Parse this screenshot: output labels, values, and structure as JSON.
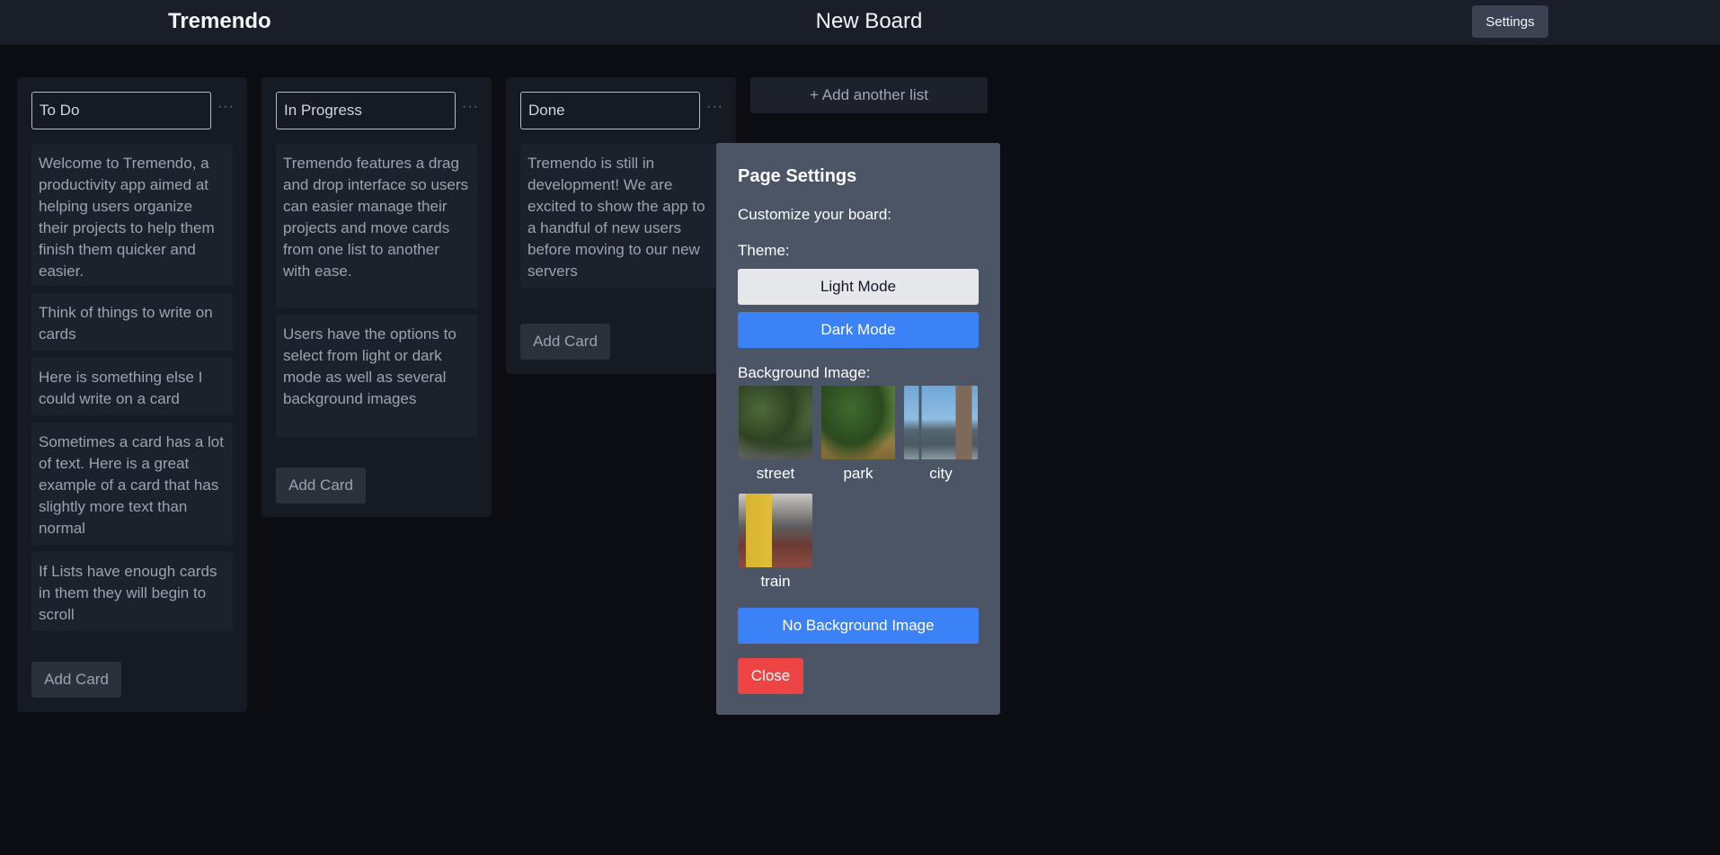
{
  "header": {
    "brand": "Tremendo",
    "board_title": "New Board",
    "settings_label": "Settings"
  },
  "lists": [
    {
      "title": "To Do",
      "menu_icon": "ellipsis-icon",
      "cards": [
        "Welcome to Tremendo, a productivity app aimed at helping users organize their projects to help them finish them quicker and easier.",
        "Think of things to write on cards",
        "Here is something else I could write on a card",
        "Sometimes a card has a lot of text. Here is a great example of a card that has slightly more text than normal",
        "If Lists have enough cards in them they will begin to scroll"
      ],
      "add_card_label": "Add Card"
    },
    {
      "title": "In Progress",
      "menu_icon": "ellipsis-icon",
      "cards": [
        "Tremendo features a drag and drop interface so users can easier manage their projects and move cards from one list to another with ease.",
        "Users have the options to select from light or dark mode as well as several background images"
      ],
      "add_card_label": "Add Card"
    },
    {
      "title": "Done",
      "menu_icon": "ellipsis-icon",
      "cards": [
        "Tremendo is still in development! We are excited to show the app to a handful of new users before moving to our new servers"
      ],
      "add_card_label": "Add Card"
    }
  ],
  "add_list_label": "+ Add another list",
  "settings_panel": {
    "title": "Page Settings",
    "subtitle": "Customize your board:",
    "theme_label": "Theme:",
    "light_mode_label": "Light Mode",
    "dark_mode_label": "Dark Mode",
    "background_label": "Background Image:",
    "backgrounds": [
      {
        "label": "street"
      },
      {
        "label": "park"
      },
      {
        "label": "city"
      },
      {
        "label": "train"
      }
    ],
    "no_background_label": "No Background Image",
    "close_label": "Close"
  },
  "colors": {
    "page_bg": "#0b0d12",
    "topbar_bg": "#1a1e28",
    "panel_bg": "#4b5566",
    "accent_blue": "#3b82f6",
    "danger_red": "#ef4444"
  }
}
